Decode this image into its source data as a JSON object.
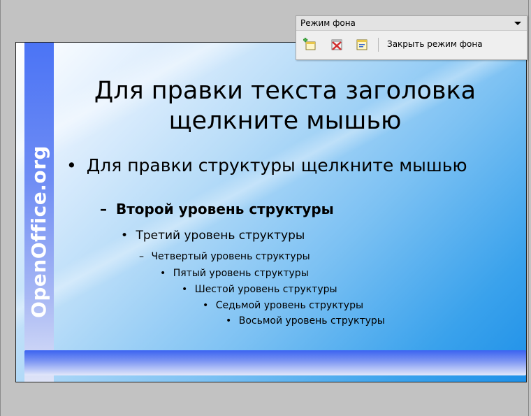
{
  "slide": {
    "side_logo": "OpenOffice.org",
    "title": "Для правки текста заголовка щелкните мышью",
    "outline": {
      "bullet": "•",
      "dash": "–",
      "level1": "Для правки структуры щелкните мышью",
      "level2": "Второй уровень структуры",
      "level3": "Третий уровень структуры",
      "level4": "Четвертый уровень структуры",
      "level5": "Пятый уровень структуры",
      "level6": "Шестой уровень структуры",
      "level7": "Седьмой уровень структуры",
      "level8": "Восьмой уровень структуры"
    }
  },
  "toolbar": {
    "title": "Режим фона",
    "buttons": [
      {
        "icon": "insert-master-icon"
      },
      {
        "icon": "delete-master-icon"
      },
      {
        "icon": "rename-master-icon"
      }
    ],
    "close_label": "Закрыть режим фона"
  }
}
